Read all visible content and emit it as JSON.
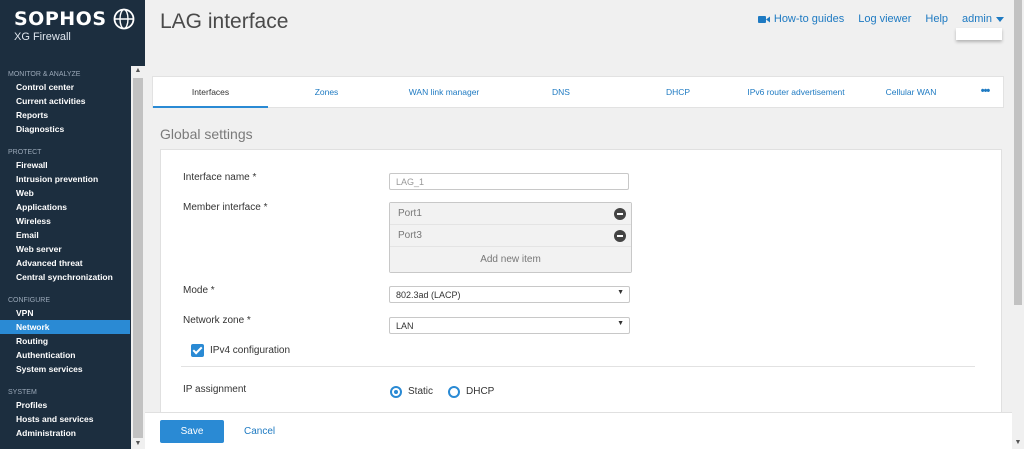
{
  "brand": {
    "name": "SOPHOS",
    "product": "XG Firewall"
  },
  "header": {
    "title": "LAG interface",
    "links": {
      "howto": "How-to guides",
      "logviewer": "Log viewer",
      "help": "Help",
      "user": "admin"
    }
  },
  "sidebar": {
    "sections": [
      {
        "heading": "MONITOR & ANALYZE",
        "items": [
          "Control center",
          "Current activities",
          "Reports",
          "Diagnostics"
        ]
      },
      {
        "heading": "PROTECT",
        "items": [
          "Firewall",
          "Intrusion prevention",
          "Web",
          "Applications",
          "Wireless",
          "Email",
          "Web server",
          "Advanced threat",
          "Central synchronization"
        ]
      },
      {
        "heading": "CONFIGURE",
        "items": [
          "VPN",
          "Network",
          "Routing",
          "Authentication",
          "System services"
        ]
      },
      {
        "heading": "SYSTEM",
        "items": [
          "Profiles",
          "Hosts and services",
          "Administration"
        ]
      }
    ],
    "active": "Network"
  },
  "tabs": {
    "items": [
      "Interfaces",
      "Zones",
      "WAN link manager",
      "DNS",
      "DHCP",
      "IPv6 router advertisement",
      "Cellular WAN"
    ],
    "active": "Interfaces",
    "more": "•••"
  },
  "section_title": "Global settings",
  "form": {
    "interface_name": {
      "label": "Interface name *",
      "placeholder": "LAG_1"
    },
    "member_interface": {
      "label": "Member interface *",
      "items": [
        "Port1",
        "Port3"
      ],
      "add_label": "Add new item"
    },
    "mode": {
      "label": "Mode *",
      "value": "802.3ad (LACP)"
    },
    "network_zone": {
      "label": "Network zone *",
      "value": "LAN"
    },
    "ipv4": {
      "label": "IPv4 configuration",
      "checked": true
    },
    "ip_assignment": {
      "label": "IP assignment",
      "options": [
        "Static",
        "DHCP"
      ],
      "selected": "Static"
    }
  },
  "footer": {
    "save": "Save",
    "cancel": "Cancel"
  },
  "colors": {
    "accent": "#2a8ad4",
    "link": "#1e7ac2",
    "sidebar_bg": "#1c2e3f"
  }
}
